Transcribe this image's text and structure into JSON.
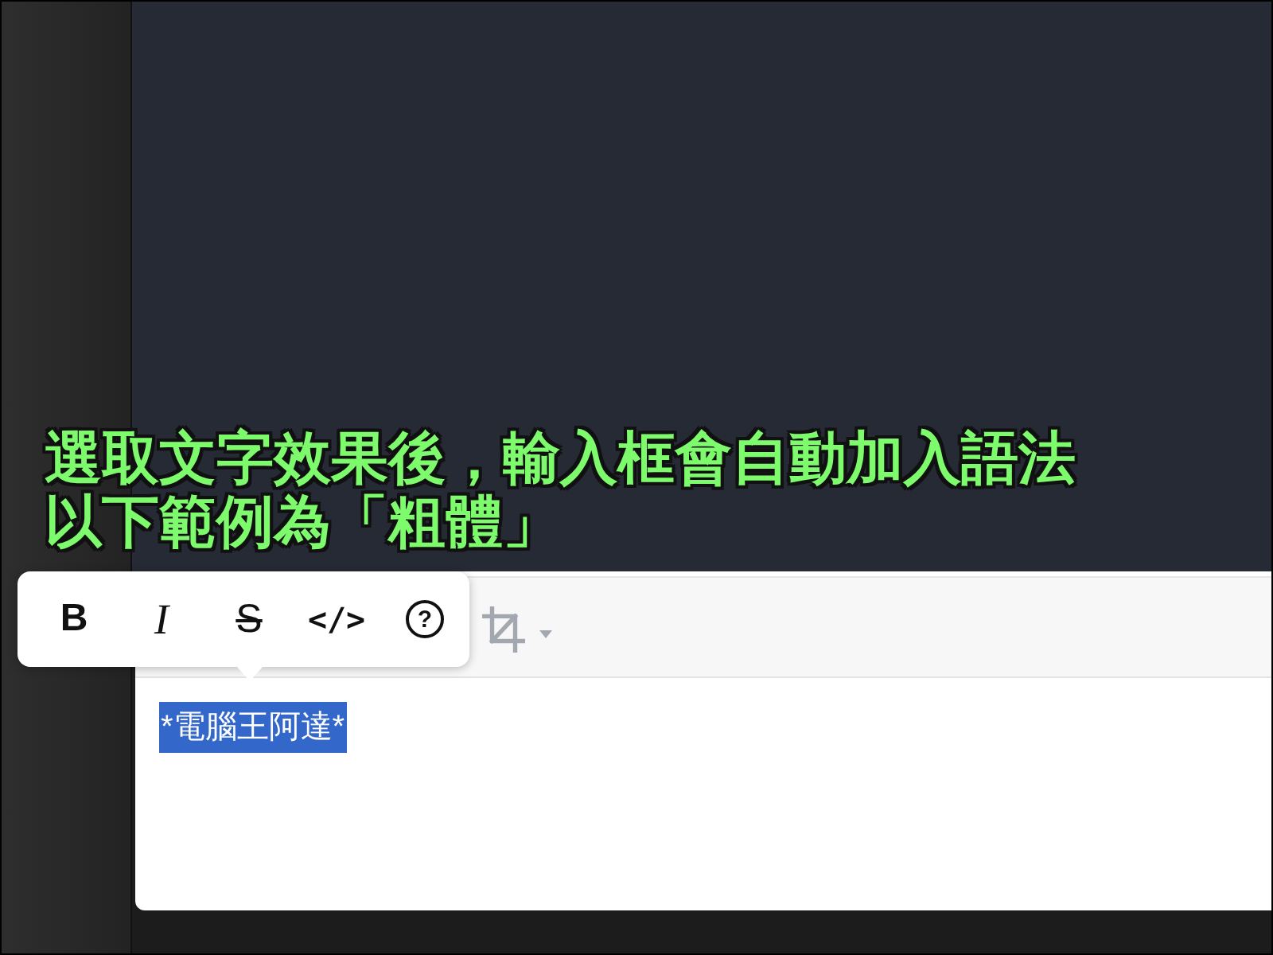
{
  "caption": {
    "lines": [
      "選取文字效果後，輸入框會自動加入語法",
      "以下範例為「粗體」"
    ]
  },
  "format_popup": {
    "buttons": [
      {
        "kind": "bold",
        "label": "B"
      },
      {
        "kind": "italic",
        "label": "I"
      },
      {
        "kind": "strikethrough",
        "label": "S"
      },
      {
        "kind": "code",
        "label": "</>"
      },
      {
        "kind": "help",
        "label": "?"
      }
    ]
  },
  "editor": {
    "toolbar": {
      "tools": [
        {
          "kind": "crop",
          "has_dropdown": true
        }
      ]
    },
    "text": {
      "value": "*電腦王阿達*",
      "selected": true
    }
  }
}
